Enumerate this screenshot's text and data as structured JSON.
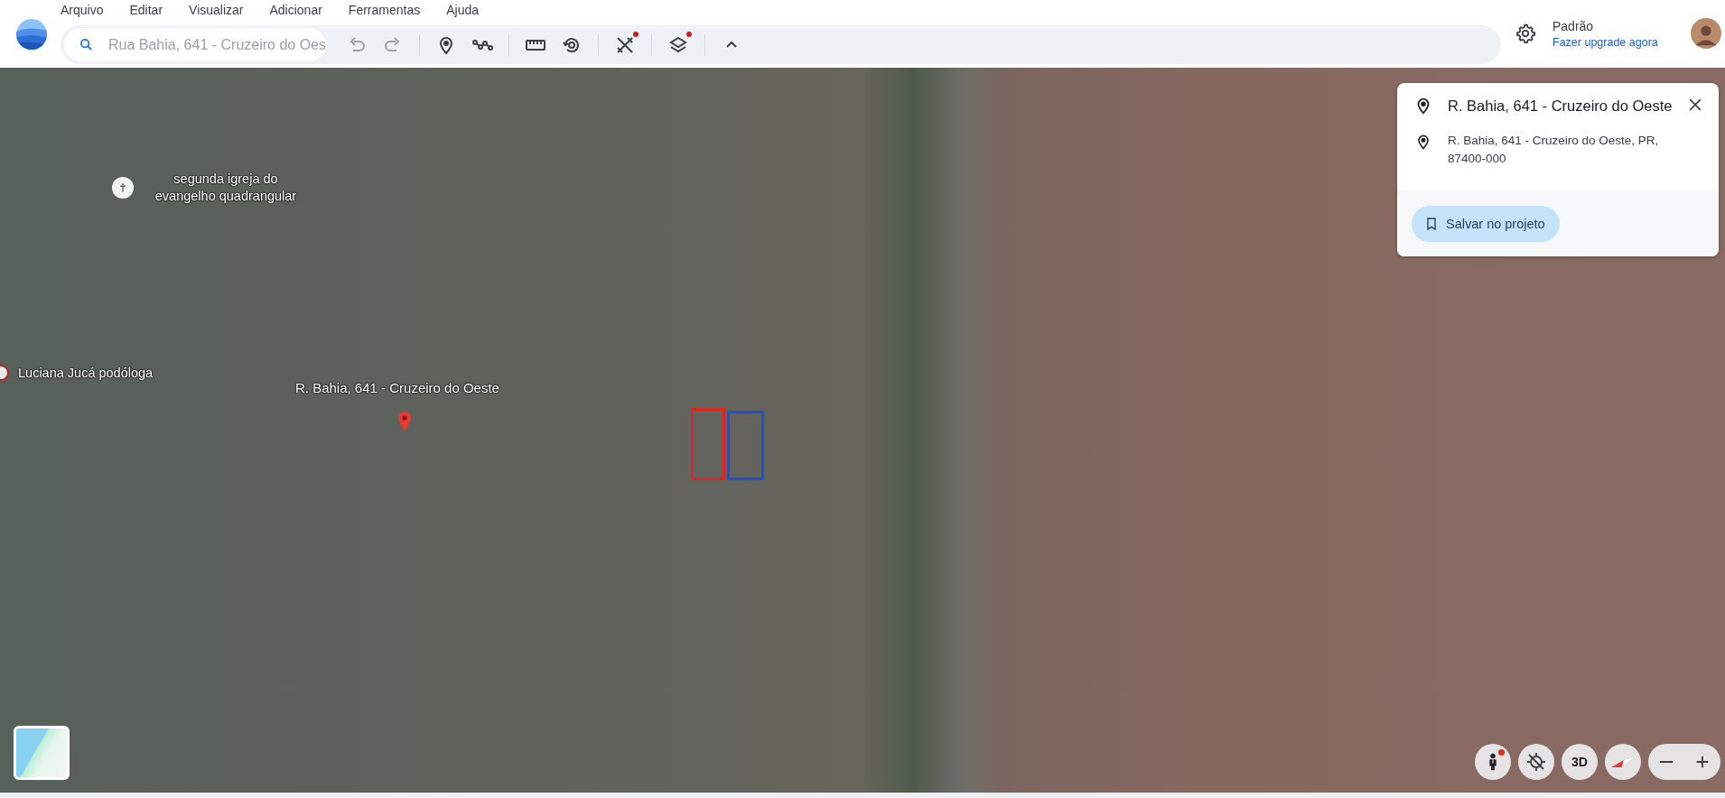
{
  "menu": [
    "Arquivo",
    "Editar",
    "Visualizar",
    "Adicionar",
    "Ferramentas",
    "Ajuda"
  ],
  "search": {
    "value": "Rua Bahia, 641 - Cruzeiro do Oes"
  },
  "toolbar": [
    [
      {
        "kind": "undo",
        "disabled": true,
        "notification": false
      },
      {
        "kind": "redo",
        "disabled": true,
        "notification": false
      }
    ],
    [
      {
        "kind": "placemark",
        "disabled": false,
        "notification": false
      },
      {
        "kind": "path",
        "disabled": false,
        "notification": false
      }
    ],
    [
      {
        "kind": "ruler",
        "disabled": false,
        "notification": false
      },
      {
        "kind": "history",
        "disabled": false,
        "notification": false
      }
    ],
    [
      {
        "kind": "tools",
        "disabled": false,
        "notification": true
      }
    ],
    [
      {
        "kind": "layers",
        "disabled": false,
        "notification": true
      }
    ],
    [
      {
        "kind": "collapse",
        "disabled": false,
        "notification": false
      }
    ]
  ],
  "account": {
    "plan": "Padrão",
    "upgrade_link": "Fazer upgrade agora"
  },
  "map": {
    "places": [
      {
        "kind": "church",
        "text": "segunda igreja do evangelho quadrangular"
      },
      {
        "kind": "business",
        "text": "Luciana Jucá podóloga"
      }
    ],
    "placemark": {
      "text": "R. Bahia, 641 - Cruzeiro do Oeste"
    },
    "polygons": [
      {
        "color": "#e02424"
      },
      {
        "color": "#1f4fd8"
      }
    ]
  },
  "info_card": {
    "title": "R. Bahia, 641 - Cruzeiro do Oeste",
    "address": "R. Bahia, 641 - Cruzeiro do Oeste, PR, 87400-000",
    "save_button": "Salvar no projeto"
  },
  "controls": [
    {
      "kind": "pegman",
      "notification": true
    },
    {
      "kind": "recenter",
      "notification": false
    },
    {
      "kind": "text",
      "label": "3D",
      "notification": false
    },
    {
      "kind": "compass",
      "notification": false
    }
  ]
}
